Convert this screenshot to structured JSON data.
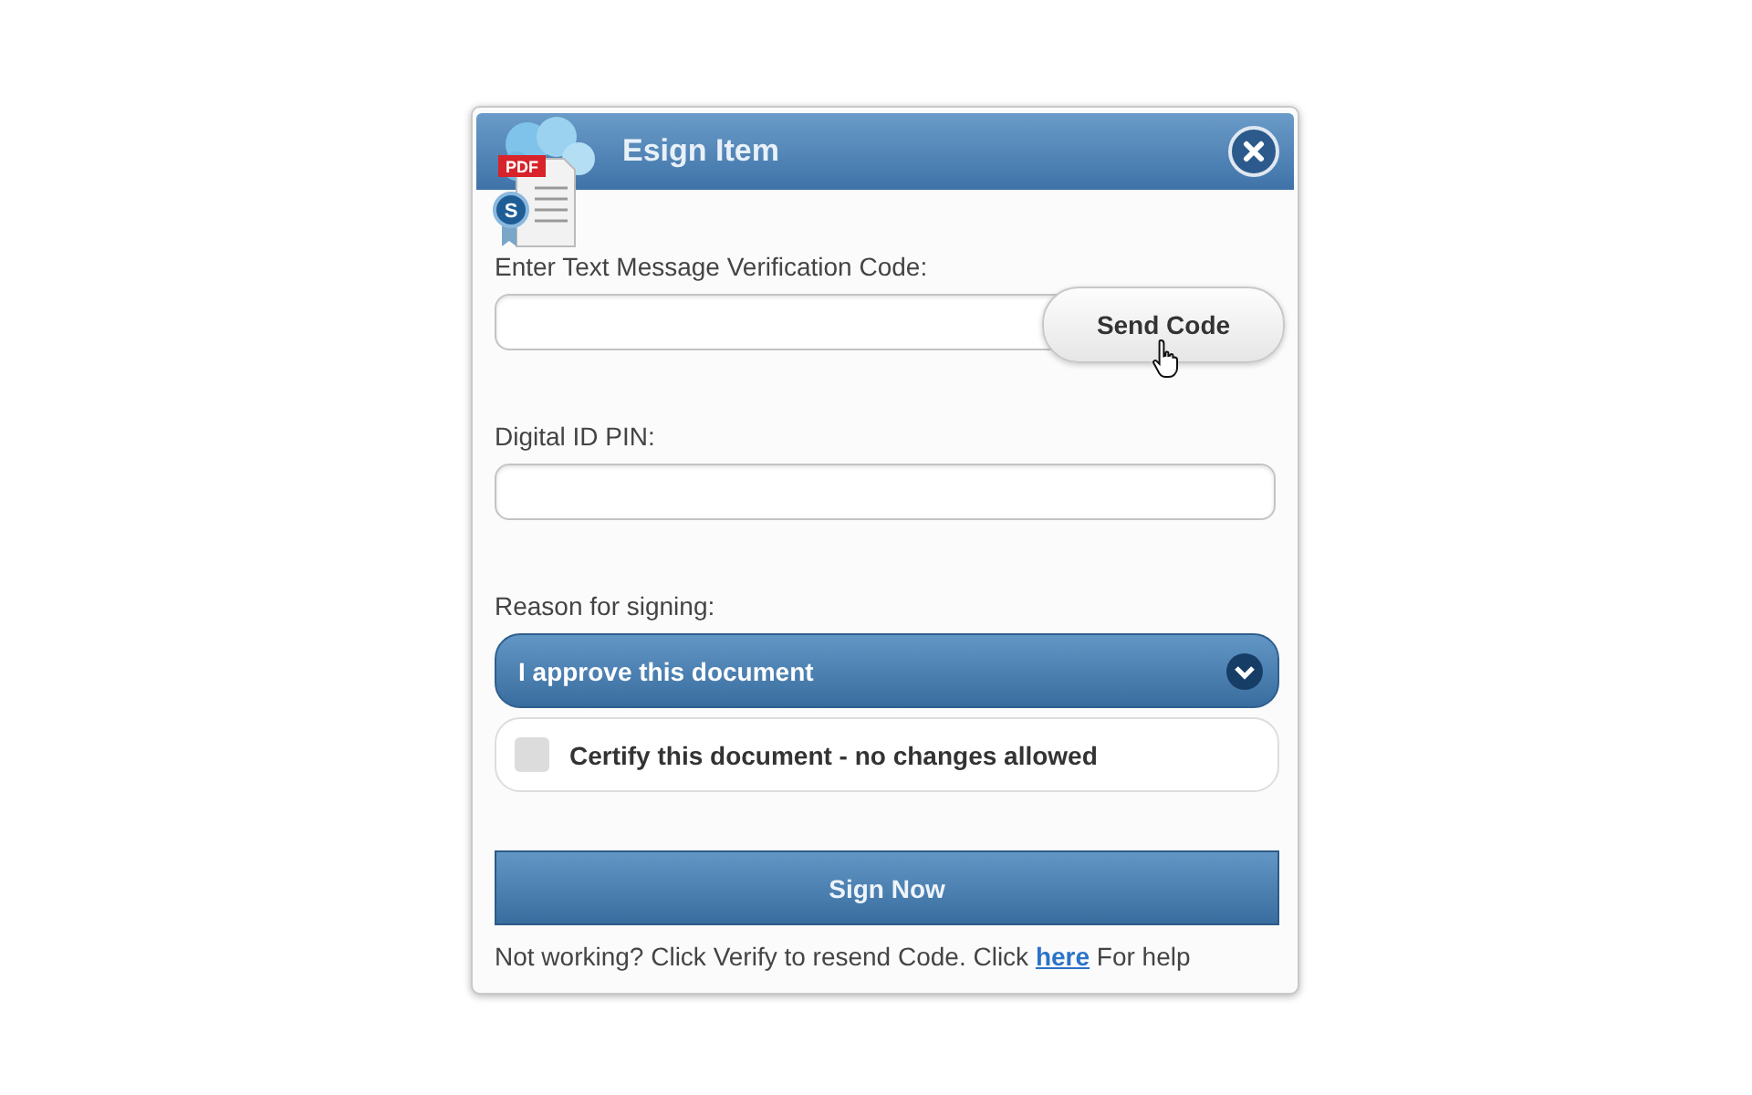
{
  "dialog": {
    "title": "Esign Item",
    "logo": {
      "badge": "PDF",
      "seal": "S"
    }
  },
  "fields": [
    {
      "label": "Enter Text Message Verification Code:",
      "kind": "code",
      "button": "Send Code"
    },
    {
      "label": "Digital ID PIN:",
      "kind": "pin"
    }
  ],
  "reason": {
    "label": "Reason for signing:",
    "value": "I approve this document"
  },
  "certify": {
    "label": "Certify this document - no changes allowed",
    "checked": false
  },
  "submit": "Sign Now",
  "help": {
    "before": "Not working? Click Verify to resend Code. Click",
    "link": "here",
    "after": "For help"
  }
}
